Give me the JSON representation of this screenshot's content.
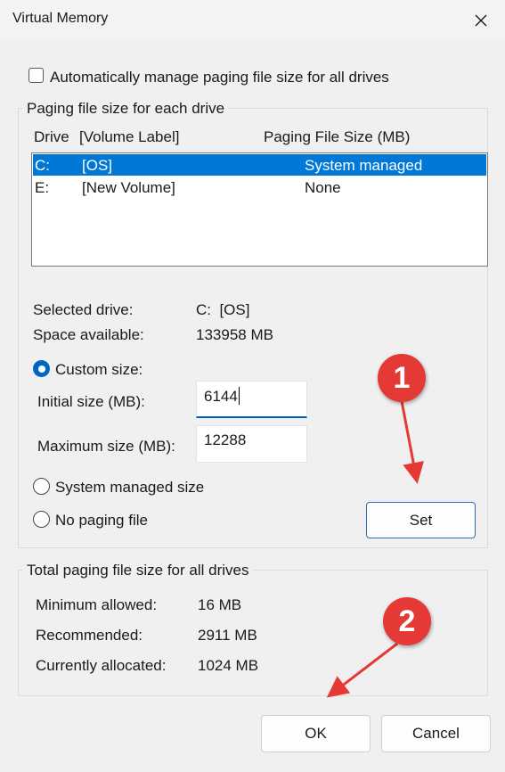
{
  "window": {
    "title": "Virtual Memory",
    "close_icon": "close-icon"
  },
  "auto_manage": {
    "label": "Automatically manage paging file size for all drives",
    "checked": false
  },
  "paging_group": {
    "title": "Paging file size for each drive",
    "columns": {
      "drive": "Drive",
      "volume": "[Volume Label]",
      "size": "Paging File Size (MB)"
    },
    "drives": [
      {
        "drive": "C:",
        "label": "[OS]",
        "size": "System managed",
        "selected": true
      },
      {
        "drive": "E:",
        "label": "[New Volume]",
        "size": "None",
        "selected": false
      }
    ],
    "selected_drive_label": "Selected drive:",
    "selected_drive_value": "C:  [OS]",
    "space_label": "Space available:",
    "space_value": "133958 MB",
    "custom_size_label": "Custom size:",
    "initial_label": "Initial size (MB):",
    "initial_value": "6144",
    "max_label": "Maximum size (MB):",
    "max_value": "12288",
    "system_managed_label": "System managed size",
    "no_paging_label": "No paging file",
    "set_label": "Set",
    "selected_option": "custom"
  },
  "total_group": {
    "title": "Total paging file size for all drives",
    "min_label": "Minimum allowed:",
    "min_value": "16 MB",
    "recommended_label": "Recommended:",
    "recommended_value": "2911 MB",
    "allocated_label": "Currently allocated:",
    "allocated_value": "1024 MB"
  },
  "footer": {
    "ok_label": "OK",
    "cancel_label": "Cancel"
  },
  "annotations": {
    "badge1": "1",
    "badge2": "2",
    "color": "#e53935"
  },
  "colors": {
    "selection": "#0078d7",
    "accent": "#005fb8"
  }
}
